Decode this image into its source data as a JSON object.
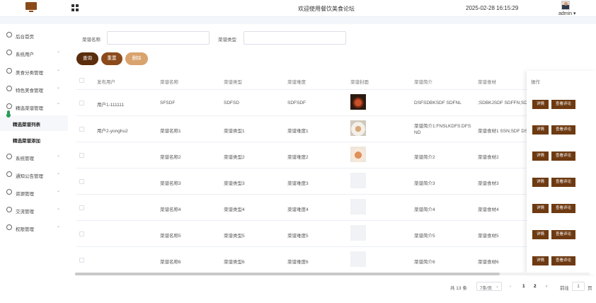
{
  "header": {
    "title": "欢迎使用餐饮美食论坛",
    "datetime": "2025-02-28 16:15:29",
    "user": "admin ▾"
  },
  "sidebar": {
    "items": [
      {
        "label": "后台首页",
        "icon": "clock-icon",
        "chevron": ""
      },
      {
        "label": "系统用户",
        "icon": "user-icon",
        "chevron": "⌄"
      },
      {
        "label": "美食分类管理",
        "icon": "tag-icon",
        "chevron": "⌄"
      },
      {
        "label": "特色美食管理",
        "icon": "card-icon",
        "chevron": "⌄"
      },
      {
        "label": "精选菜谱管理",
        "icon": "book-icon",
        "chevron": "⌃"
      },
      {
        "label": "系统管理",
        "icon": "folder-icon",
        "chevron": "⌄"
      },
      {
        "label": "通知公告管理",
        "icon": "link-icon",
        "chevron": "⌄"
      },
      {
        "label": "资源管理",
        "icon": "box-icon",
        "chevron": "⌄"
      },
      {
        "label": "交流管理",
        "icon": "headset-icon",
        "chevron": "⌄"
      },
      {
        "label": "权限管理",
        "icon": "person-icon",
        "chevron": "⌄"
      }
    ],
    "subitems": [
      {
        "label": "精选菜谱列表"
      },
      {
        "label": "精选菜谱添加"
      }
    ]
  },
  "search": {
    "name_label": "菜谱名称",
    "name_value": "",
    "type_label": "菜谱类型",
    "type_value": ""
  },
  "buttons": {
    "query": "查询",
    "reset": "重置",
    "delete": "删除"
  },
  "table": {
    "headers": {
      "publisher": "发布用户",
      "name": "菜谱名称",
      "type": "菜谱类型",
      "difficulty": "菜谱难度",
      "cover": "菜谱封面",
      "intro": "菜谱简介",
      "ingredients": "菜谱食材",
      "ops": "操作"
    },
    "rows": [
      {
        "publisher": "用户1-111111",
        "name": "SFSDF",
        "type": "SDFSD",
        "difficulty": "SDFSDF",
        "intro": "DSFSDBKSDF SDFNL",
        "ingredients": ";SDBKJSDF SDFFN;SDF"
      },
      {
        "publisher": "用户2-yonghu2",
        "name": "菜谱名称1",
        "type": "菜谱类型1",
        "difficulty": "菜谱难度1",
        "intro": "菜谱简介1:FNSLKDFS:DFS ND",
        "ingredients": "菜谱食材1 SSN;SDF DSF"
      },
      {
        "publisher": "",
        "name": "菜谱名称2",
        "type": "菜谱类型2",
        "difficulty": "菜谱难度2",
        "intro": "菜谱简介2",
        "ingredients": "菜谱食材2"
      },
      {
        "publisher": "",
        "name": "菜谱名称3",
        "type": "菜谱类型3",
        "difficulty": "菜谱难度3",
        "intro": "菜谱简介3",
        "ingredients": "菜谱食材3"
      },
      {
        "publisher": "",
        "name": "菜谱名称4",
        "type": "菜谱类型4",
        "difficulty": "菜谱难度4",
        "intro": "菜谱简介4",
        "ingredients": "菜谱食材4"
      },
      {
        "publisher": "",
        "name": "菜谱名称5",
        "type": "菜谱类型5",
        "difficulty": "菜谱难度5",
        "intro": "菜谱简介5",
        "ingredients": "菜谱食材5"
      },
      {
        "publisher": "",
        "name": "菜谱名称6",
        "type": "菜谱类型6",
        "difficulty": "菜谱难度6",
        "intro": "菜谱简介6",
        "ingredients": "菜谱食材6"
      }
    ],
    "op_detail": "详情",
    "op_comment": "查看评论"
  },
  "pagination": {
    "total": "共 13 条",
    "page_size": "7条/页",
    "size_arrow": "⌄",
    "prev": "‹",
    "page1": "1",
    "page2": "2",
    "next": "›",
    "goto_label": "前往",
    "goto_value": "1",
    "page_suffix": "页"
  }
}
